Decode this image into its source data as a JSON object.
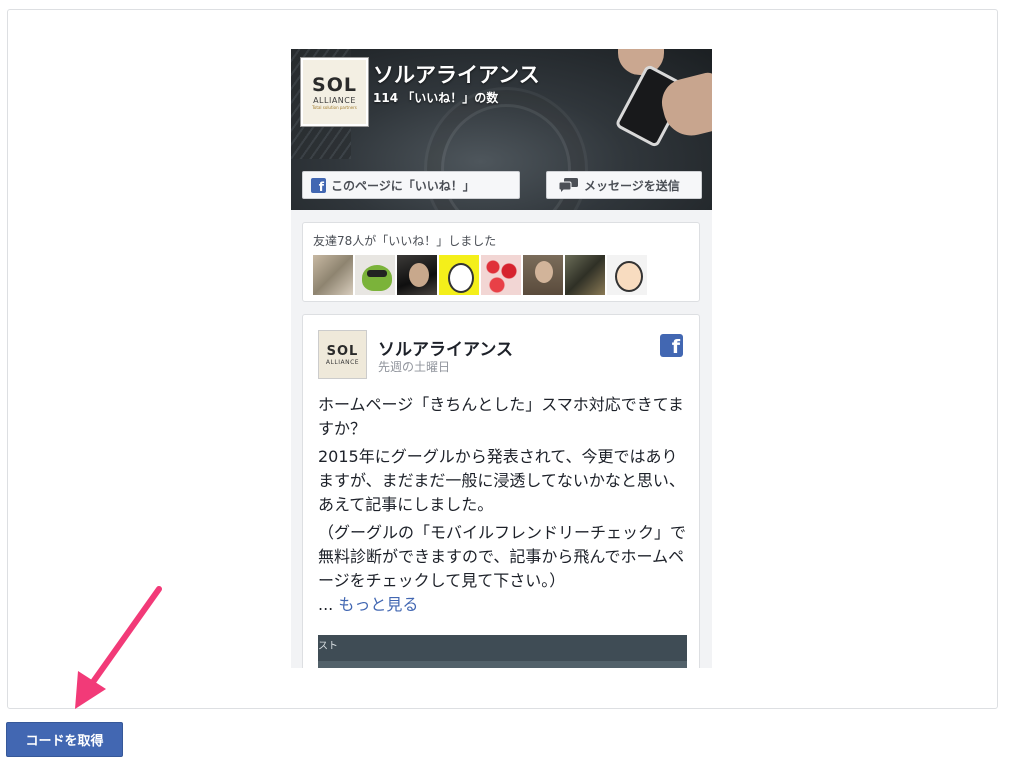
{
  "plugin": {
    "page_name": "ソルアライアンス",
    "likes_text": "114 「いいね！」の数",
    "logo": {
      "line1": "SOL",
      "line2": "ALLIANCE",
      "line3": "Total solution partners"
    },
    "like_button_label": "このページに「いいね！」",
    "message_button_label": "メッセージを送信",
    "friends_text": "友達78人が「いいね！」しました",
    "friends_avatar_count": 8
  },
  "post": {
    "author": "ソルアライアンス",
    "time": "先週の土曜日",
    "paragraph1": "ホームページ「きちんとした」スマホ対応できてますか？",
    "paragraph2": "2015年にグーグルから発表されて、今更ではありますが、まだまだ一般に浸透してないかなと思い、あえて記事にしました。",
    "paragraph3": "（グーグルの「モバイルフレンドリーチェック」で無料診断ができますので、記事から飛んでホームページをチェックして見て下さい。）",
    "ellipsis": "...",
    "see_more": "もっと見る",
    "image_caption": "スト"
  },
  "get_code_button": "コードを取得",
  "colors": {
    "facebook_blue": "#4267b2",
    "arrow_pink": "#f23a78",
    "card_border": "#dddfe2"
  },
  "icons": [
    "facebook-f-icon",
    "message-bubbles-icon",
    "annotation-arrow-icon"
  ]
}
